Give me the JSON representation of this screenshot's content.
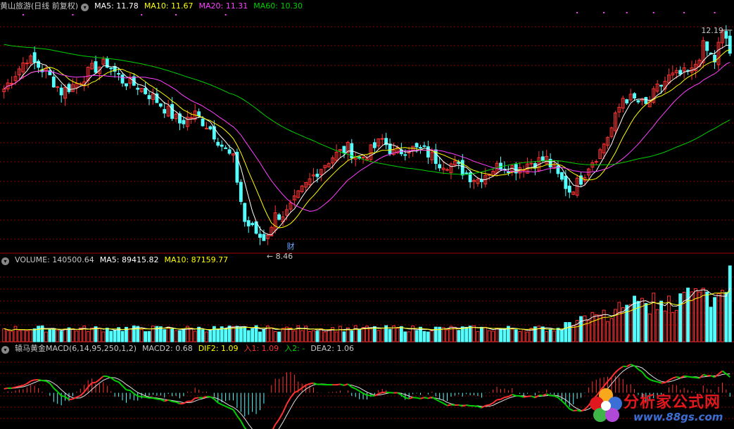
{
  "price_header": {
    "title": "黄山旅游(日线 前复权)",
    "ma5": "MA5: 11.78",
    "ma10": "MA10: 11.67",
    "ma20": "MA20: 11.31",
    "ma60": "MA60: 10.30"
  },
  "volume_header": {
    "volume": "VOLUME: 140500.64",
    "ma5": "MA5: 89415.82",
    "ma10": "MA10: 87159.77"
  },
  "macd_header": {
    "name": "辕马黄金MACD(6,14,95,250,1,2)",
    "macd2": "MACD2: 0.68",
    "dif2": "DIF2: 1.09",
    "in1": "入1: 1.09",
    "in2": "入2: -",
    "dea2": "DEA2: 1.06"
  },
  "annotations": {
    "high": "12.19",
    "low": "8.46",
    "cai": "财"
  },
  "watermark": {
    "cn": "分析家公式网",
    "url": "www.88gs.com"
  },
  "colors": {
    "up": "#ff3232",
    "down": "#54ffff",
    "ma5": "#ffffff",
    "ma10": "#ffff00",
    "ma20": "#ff40ff",
    "ma60": "#00d000",
    "grid": "#8b0000"
  },
  "chart_data": {
    "type": "candlestick",
    "price_range": [
      8.3,
      12.5
    ],
    "price_keyframes": [
      [
        0,
        11.15
      ],
      [
        6,
        11.7
      ],
      [
        11,
        11.45
      ],
      [
        15,
        11.1
      ],
      [
        19,
        11.25
      ],
      [
        23,
        11.5
      ],
      [
        27,
        11.6
      ],
      [
        31,
        11.3
      ],
      [
        35,
        11.2
      ],
      [
        39,
        11.0
      ],
      [
        43,
        10.75
      ],
      [
        46,
        10.55
      ],
      [
        50,
        10.7
      ],
      [
        54,
        10.45
      ],
      [
        58,
        10.05
      ],
      [
        60,
        9.9
      ],
      [
        63,
        8.8
      ],
      [
        66,
        8.6
      ],
      [
        68,
        8.46
      ],
      [
        71,
        8.9
      ],
      [
        74,
        8.95
      ],
      [
        78,
        9.35
      ],
      [
        82,
        9.7
      ],
      [
        86,
        9.95
      ],
      [
        90,
        10.1
      ],
      [
        93,
        9.9
      ],
      [
        96,
        10.05
      ],
      [
        99,
        10.25
      ],
      [
        102,
        10.0
      ],
      [
        106,
        10.1
      ],
      [
        110,
        10.05
      ],
      [
        114,
        9.85
      ],
      [
        118,
        9.8
      ],
      [
        122,
        9.6
      ],
      [
        124,
        9.55
      ],
      [
        127,
        9.7
      ],
      [
        130,
        9.8
      ],
      [
        134,
        9.75
      ],
      [
        138,
        9.85
      ],
      [
        142,
        9.9
      ],
      [
        145,
        9.6
      ],
      [
        148,
        9.35
      ],
      [
        151,
        9.55
      ],
      [
        153,
        9.8
      ],
      [
        156,
        10.05
      ],
      [
        159,
        10.45
      ],
      [
        162,
        11.0
      ],
      [
        165,
        10.95
      ],
      [
        168,
        10.85
      ],
      [
        171,
        11.15
      ],
      [
        174,
        11.35
      ],
      [
        177,
        11.4
      ],
      [
        180,
        11.45
      ],
      [
        183,
        11.9
      ],
      [
        186,
        11.65
      ],
      [
        188,
        12.19
      ],
      [
        190,
        11.78
      ]
    ],
    "candle_count": 191,
    "volume_range": [
      0,
      140500.64
    ],
    "macd_range": [
      -1.2,
      1.3
    ]
  }
}
